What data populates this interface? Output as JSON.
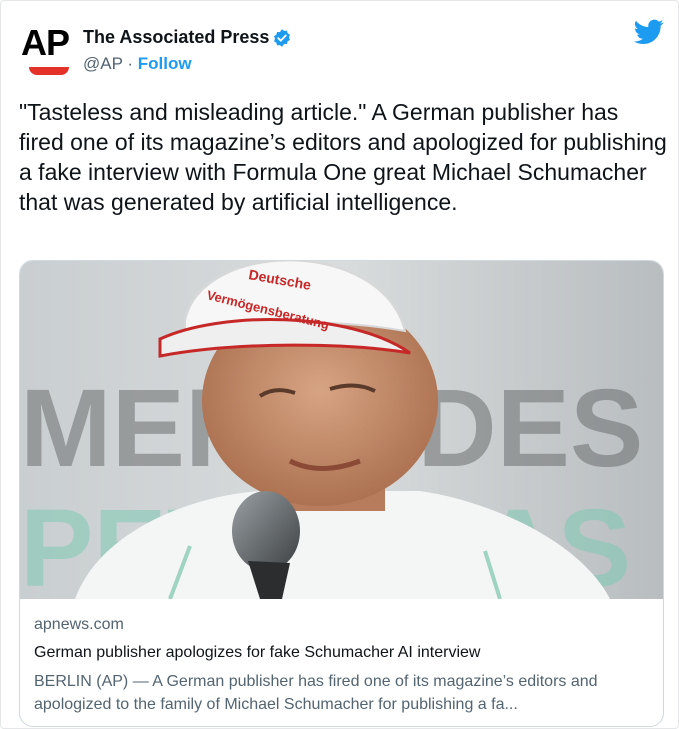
{
  "author": {
    "logo_text": "AP",
    "name": "The Associated Press",
    "handle": "@AP",
    "separator": "·",
    "follow_label": "Follow"
  },
  "tweet": {
    "text": "\"Tasteless and misleading article.\" A German publisher has fired one of its magazine’s editors and apologized for publishing a fake interview with Formula One great Michael Schumacher that was generated by artificial intelligence."
  },
  "card": {
    "domain": "apnews.com",
    "title": "German publisher apologizes for fake Schumacher AI interview",
    "description": "BERLIN (AP) — A German publisher has fired one of its magazine’s editors and apologized to the family of Michael Schumacher for publishing a fa...",
    "image": {
      "cap_line1": "Deutsche",
      "cap_line2": "Vermögensberatung",
      "background_text_top": "MERCEDES",
      "background_text_bottom": "PETRONAS"
    }
  },
  "colors": {
    "accent": "#1d9bf0",
    "ap_red": "#e4322b",
    "verified": "#1d9bf0"
  },
  "icons": [
    "verified-badge-icon",
    "twitter-bird-icon"
  ]
}
